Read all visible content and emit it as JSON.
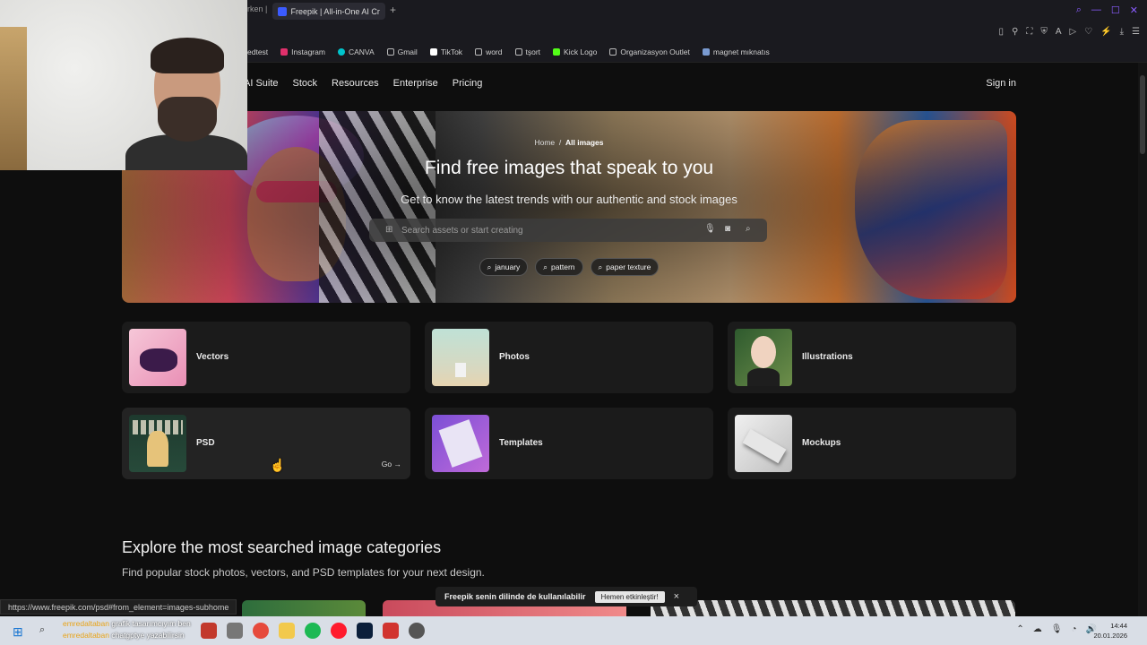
{
  "browser": {
    "prev_tab_title": "rken |",
    "active_tab_title": "Freepik | All-in-One AI Cre",
    "new_tab_icon": "plus-icon",
    "status_url": "https://www.freepik.com/psd#from_element=images-subhome"
  },
  "bookmarks": [
    {
      "label": "edtest",
      "color": "#888888"
    },
    {
      "label": "Instagram",
      "color": "#e1306c"
    },
    {
      "label": "CANVA",
      "color": "#00c4cc"
    },
    {
      "label": "Gmail",
      "color": "#bbbbbb"
    },
    {
      "label": "TikTok",
      "color": "#ffffff"
    },
    {
      "label": "word",
      "color": "#bbbbbb"
    },
    {
      "label": "tşort",
      "color": "#bbbbbb"
    },
    {
      "label": "Kick Logo",
      "color": "#53fc18"
    },
    {
      "label": "Organizasyon Outlet",
      "color": "#bbbbbb"
    },
    {
      "label": "magnet mıknatıs",
      "color": "#7a9bd1"
    }
  ],
  "nav": {
    "links": [
      "AI Suite",
      "Stock",
      "Resources",
      "Enterprise",
      "Pricing"
    ],
    "sign_in": "Sign in"
  },
  "hero": {
    "breadcrumb_home": "Home",
    "breadcrumb_sep": "/",
    "breadcrumb_current": "All images",
    "title": "Find free images that speak to you",
    "subtitle": "Get to know the latest trends with our authentic and stock images",
    "search_placeholder": "Search assets or start creating",
    "chips": [
      "january",
      "pattern",
      "paper texture"
    ]
  },
  "categories": [
    {
      "label": "Vectors"
    },
    {
      "label": "Photos"
    },
    {
      "label": "Illustrations"
    },
    {
      "label": "PSD",
      "go": "Go"
    },
    {
      "label": "Templates"
    },
    {
      "label": "Mockups"
    }
  ],
  "explore": {
    "title": "Explore the most searched image categories",
    "subtitle": "Find popular stock photos, vectors, and PSD templates for your next design."
  },
  "toast": {
    "text": "Freepik senin dilinde de kullanılabilir",
    "button": "Hemen etkinleştir!",
    "close": "×"
  },
  "taskbar": {
    "clock_time": "14:44",
    "clock_date": "20.01.2026",
    "chat": [
      {
        "user": "emredaltaban",
        "msg": "grafik tasarımcıyım ben"
      },
      {
        "user": "emredaltaban",
        "msg": "chatgptye yazabilirsin"
      }
    ]
  },
  "accent_color": "#8a5cff"
}
